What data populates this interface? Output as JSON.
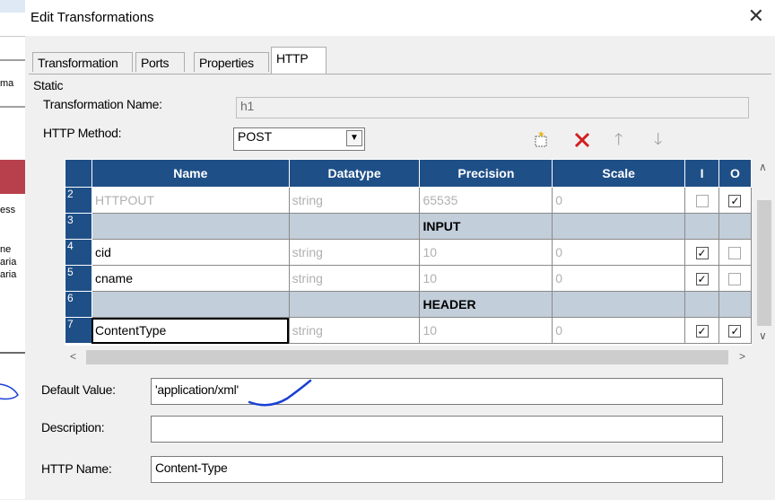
{
  "background_window": {
    "fragments": [
      "ma",
      "ess",
      "ne",
      "aria",
      "aria"
    ]
  },
  "dialog": {
    "title": "Edit Transformations",
    "close_glyph": "✕",
    "tabs": [
      {
        "label": "Transformation",
        "active": false
      },
      {
        "label": "Ports",
        "active": false
      },
      {
        "label": "Properties",
        "active": false
      },
      {
        "label": "HTTP",
        "active": true
      }
    ],
    "static_label": "Static",
    "transformation_name": {
      "label": "Transformation Name:",
      "value": "h1"
    },
    "http_method": {
      "label": "HTTP Method:",
      "value": "POST"
    },
    "toolbar_icons": [
      "new-port-icon",
      "delete-icon",
      "move-up-icon",
      "move-down-icon"
    ],
    "grid": {
      "columns": [
        "Name",
        "Datatype",
        "Precision",
        "Scale",
        "I",
        "O"
      ],
      "rows": [
        {
          "num": "2",
          "name": "HTTPOUT",
          "datatype": "string",
          "precision": "65535",
          "scale": "0",
          "i": false,
          "o": true,
          "dim": true
        },
        {
          "num": "3",
          "separator": "INPUT"
        },
        {
          "num": "4",
          "name": "cid",
          "datatype": "string",
          "precision": "10",
          "scale": "0",
          "i": true,
          "o": false
        },
        {
          "num": "5",
          "name": "cname",
          "datatype": "string",
          "precision": "10",
          "scale": "0",
          "i": true,
          "o": false
        },
        {
          "num": "6",
          "separator": "HEADER"
        },
        {
          "num": "7",
          "name": "ContentType",
          "datatype": "string",
          "precision": "10",
          "scale": "0",
          "i": true,
          "o": true,
          "selected": true
        }
      ]
    },
    "default_value": {
      "label": "Default Value:",
      "value": "'application/xml'"
    },
    "description": {
      "label": "Description:",
      "value": ""
    },
    "http_name": {
      "label": "HTTP Name:",
      "value": "Content-Type"
    },
    "colors": {
      "header_blue": "#1f4f87",
      "separator_row": "#c2ceda",
      "annotation_blue": "#1a3fd6",
      "delete_red": "#d21f1f"
    }
  }
}
